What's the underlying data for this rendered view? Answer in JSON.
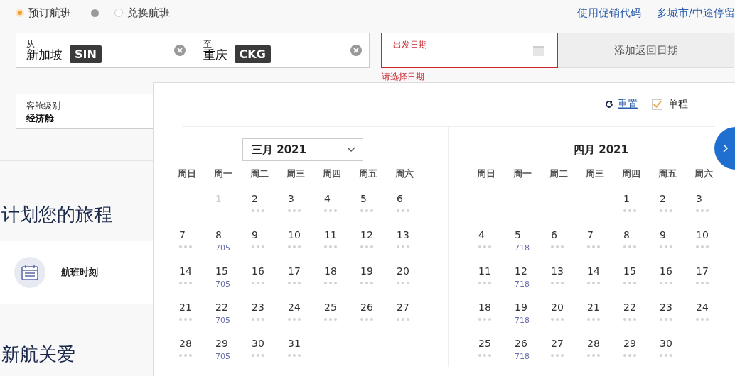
{
  "trip_types": [
    {
      "label": "预订航班",
      "selected": true,
      "info": true
    },
    {
      "label": "兑换航班",
      "selected": false,
      "info": false
    }
  ],
  "links": [
    "使用促销代码",
    "多城市/中途停留"
  ],
  "from": {
    "label": "从",
    "city": "新加坡",
    "code": "SIN"
  },
  "to": {
    "label": "至",
    "city": "重庆",
    "code": "CKG"
  },
  "departure": {
    "placeholder": "出发日期",
    "error": "请选择日期"
  },
  "return_button": "添加返回日期",
  "cabin": {
    "label": "客舱级别",
    "value": "经济舱"
  },
  "plan_heading": "计划您的旅程",
  "plan_items": [
    {
      "label": "航班时刻"
    }
  ],
  "care_heading": "新航关爱",
  "calendar": {
    "reset": "重置",
    "one_way": {
      "label": "单程",
      "checked": true
    },
    "months": [
      {
        "kind": "select",
        "title": "三月 2021",
        "weekdays": [
          "周日",
          "周一",
          "周二",
          "周三",
          "周四",
          "周五",
          "周六"
        ],
        "weeks": [
          [
            {
              "kind": "empty"
            },
            {
              "day": "1",
              "disabled": true
            },
            {
              "day": "2",
              "disabled": false
            },
            {
              "day": "3",
              "disabled": false
            },
            {
              "day": "4",
              "disabled": false
            },
            {
              "day": "5",
              "disabled": false
            },
            {
              "day": "6",
              "disabled": false
            }
          ],
          [
            {
              "day": "7",
              "disabled": false
            },
            {
              "day": "8",
              "disabled": false,
              "price": "705"
            },
            {
              "day": "9",
              "disabled": false
            },
            {
              "day": "10",
              "disabled": false
            },
            {
              "day": "11",
              "disabled": false
            },
            {
              "day": "12",
              "disabled": false
            },
            {
              "day": "13",
              "disabled": false
            }
          ],
          [
            {
              "day": "14",
              "disabled": false
            },
            {
              "day": "15",
              "disabled": false,
              "price": "705"
            },
            {
              "day": "16",
              "disabled": false
            },
            {
              "day": "17",
              "disabled": false
            },
            {
              "day": "18",
              "disabled": false
            },
            {
              "day": "19",
              "disabled": false
            },
            {
              "day": "20",
              "disabled": false
            }
          ],
          [
            {
              "day": "21",
              "disabled": false
            },
            {
              "day": "22",
              "disabled": false,
              "price": "705"
            },
            {
              "day": "23",
              "disabled": false
            },
            {
              "day": "24",
              "disabled": false
            },
            {
              "day": "25",
              "disabled": false
            },
            {
              "day": "26",
              "disabled": false
            },
            {
              "day": "27",
              "disabled": false
            }
          ],
          [
            {
              "day": "28",
              "disabled": false
            },
            {
              "day": "29",
              "disabled": false,
              "price": "705"
            },
            {
              "day": "30",
              "disabled": false
            },
            {
              "day": "31",
              "disabled": false
            },
            {
              "kind": "empty"
            },
            {
              "kind": "empty"
            },
            {
              "kind": "empty"
            }
          ]
        ]
      },
      {
        "kind": "title",
        "title": "四月 2021",
        "weekdays": [
          "周日",
          "周一",
          "周二",
          "周三",
          "周四",
          "周五",
          "周六"
        ],
        "weeks": [
          [
            {
              "kind": "empty"
            },
            {
              "kind": "empty"
            },
            {
              "kind": "empty"
            },
            {
              "kind": "empty"
            },
            {
              "day": "1",
              "disabled": false
            },
            {
              "day": "2",
              "disabled": false
            },
            {
              "day": "3",
              "disabled": false
            }
          ],
          [
            {
              "day": "4",
              "disabled": false
            },
            {
              "day": "5",
              "disabled": false,
              "price": "718"
            },
            {
              "day": "6",
              "disabled": false
            },
            {
              "day": "7",
              "disabled": false
            },
            {
              "day": "8",
              "disabled": false
            },
            {
              "day": "9",
              "disabled": false
            },
            {
              "day": "10",
              "disabled": false
            }
          ],
          [
            {
              "day": "11",
              "disabled": false
            },
            {
              "day": "12",
              "disabled": false,
              "price": "718"
            },
            {
              "day": "13",
              "disabled": false
            },
            {
              "day": "14",
              "disabled": false
            },
            {
              "day": "15",
              "disabled": false
            },
            {
              "day": "16",
              "disabled": false
            },
            {
              "day": "17",
              "disabled": false
            }
          ],
          [
            {
              "day": "18",
              "disabled": false
            },
            {
              "day": "19",
              "disabled": false,
              "price": "718"
            },
            {
              "day": "20",
              "disabled": false
            },
            {
              "day": "21",
              "disabled": false
            },
            {
              "day": "22",
              "disabled": false
            },
            {
              "day": "23",
              "disabled": false
            },
            {
              "day": "24",
              "disabled": false
            }
          ],
          [
            {
              "day": "25",
              "disabled": false
            },
            {
              "day": "26",
              "disabled": false,
              "price": "718"
            },
            {
              "day": "27",
              "disabled": false
            },
            {
              "day": "28",
              "disabled": false
            },
            {
              "day": "29",
              "disabled": false
            },
            {
              "day": "30",
              "disabled": false
            },
            {
              "kind": "empty"
            }
          ]
        ]
      }
    ]
  }
}
